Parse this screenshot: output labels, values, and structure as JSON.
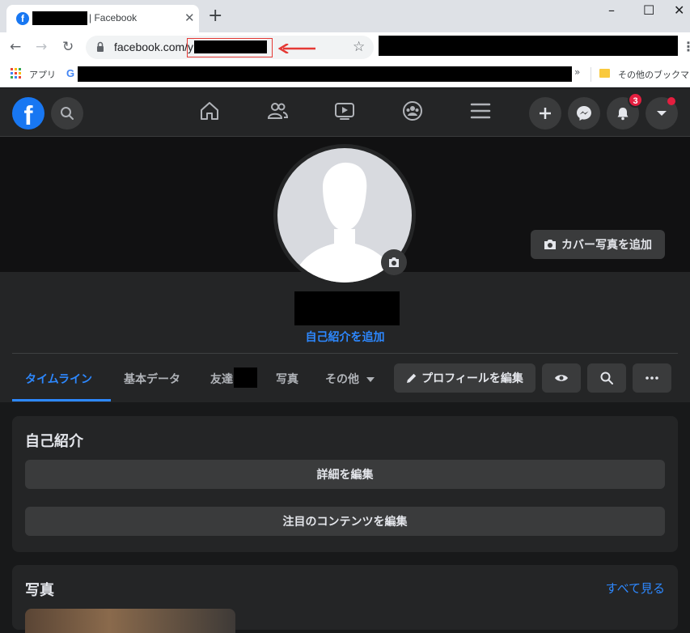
{
  "browser": {
    "tab_title": "| Facebook",
    "tab_favicon": "f",
    "new_tab_glyph": "+",
    "close_glyph": "✕",
    "url": "facebook.com/y",
    "apps_label": "アプリ",
    "other_bookmarks": "その他のブックマーク",
    "bookmarks_overflow": "»",
    "google_glyph": "G"
  },
  "window_controls": {
    "minimize": "–",
    "maximize": "☐",
    "close": "✕"
  },
  "fb_header": {
    "logo": "f",
    "notification_count": "3"
  },
  "profile": {
    "add_cover_label": "カバー写真を追加",
    "add_bio_label": "自己紹介を追加",
    "edit_profile_label": "プロフィールを編集",
    "tabs": [
      "タイムライン",
      "基本データ",
      "友達",
      "写真",
      "その他"
    ]
  },
  "intro_card": {
    "title": "自己紹介",
    "edit_details_label": "詳細を編集",
    "edit_featured_label": "注目のコンテンツを編集"
  },
  "photos_card": {
    "title": "写真",
    "see_all_label": "すべて見る"
  },
  "icons": [
    "facebook-icon",
    "search-icon",
    "home-icon",
    "friends-icon",
    "watch-icon",
    "groups-icon",
    "menu-icon",
    "plus-icon",
    "messenger-icon",
    "bell-icon",
    "caret-down-icon",
    "camera-icon",
    "pencil-icon",
    "eye-icon",
    "more-icon",
    "lock-icon",
    "star-icon",
    "apps-icon",
    "folder-icon"
  ],
  "colors": {
    "accent": "#2d88ff",
    "fb_blue": "#1877f2",
    "badge_red": "#e41e3f",
    "annotation_red": "#e53935"
  }
}
